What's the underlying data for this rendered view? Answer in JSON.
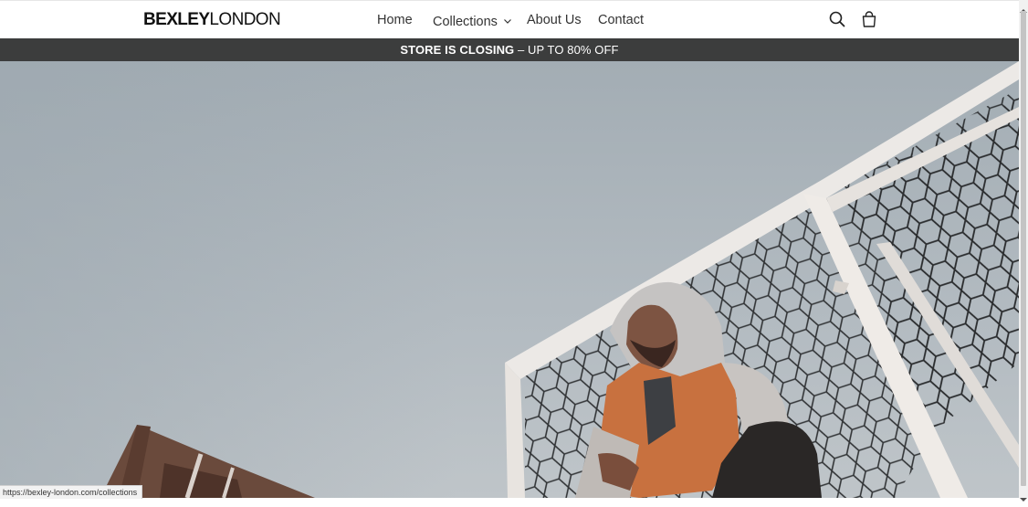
{
  "header": {
    "logo_bold": "BEXLEY",
    "logo_thin": "LONDON",
    "nav": {
      "home": "Home",
      "collections": "Collections",
      "about": "About Us",
      "contact": "Contact"
    },
    "icons": [
      "search-icon",
      "cart-icon",
      "chevron-down-icon"
    ]
  },
  "announcement": {
    "strong": "STORE IS CLOSING",
    "rest": " – UP TO 80% OFF"
  },
  "hero": {
    "description_icon": "hero-image"
  },
  "status_bar": {
    "url": "https://bexley-london.com/collections"
  },
  "colors": {
    "announcement_bg": "#3c3d3d",
    "sky": "#a9b3ba",
    "frame": "#e9e6e3"
  }
}
